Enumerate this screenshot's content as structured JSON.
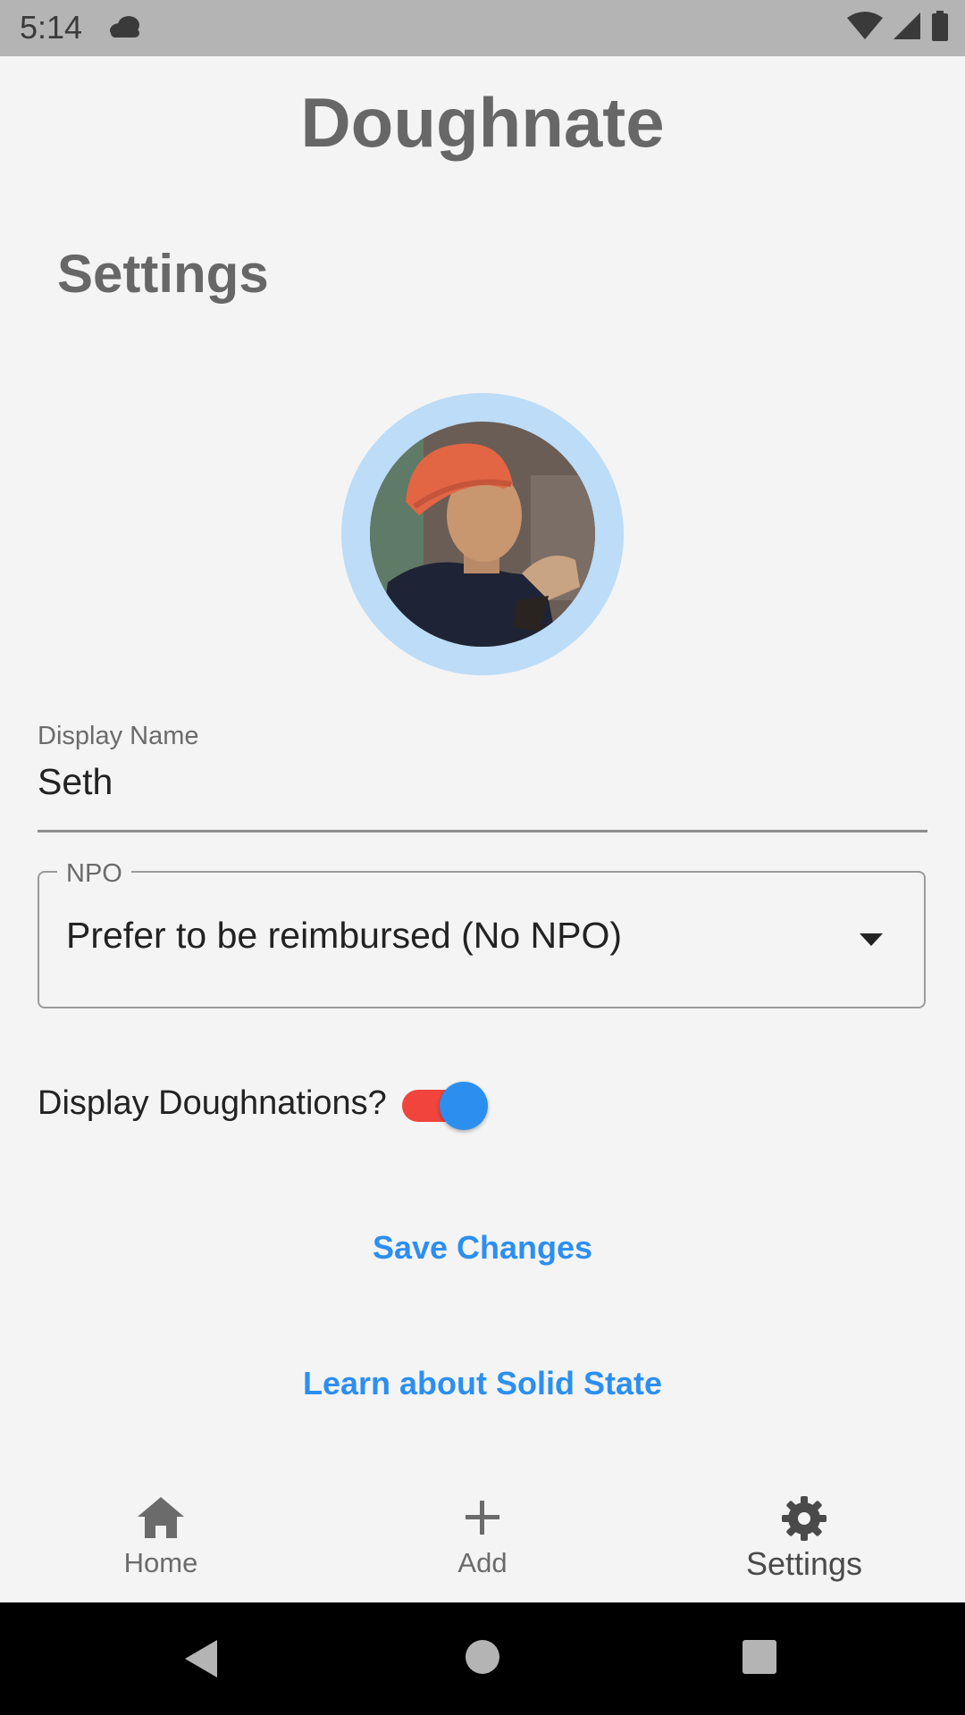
{
  "status_bar": {
    "time": "5:14"
  },
  "header": {
    "app_title": "Doughnate",
    "page_title": "Settings"
  },
  "profile": {
    "display_name_label": "Display Name",
    "display_name_value": "Seth"
  },
  "npo": {
    "label": "NPO",
    "selected": "Prefer to be reimbursed (No NPO)"
  },
  "toggle": {
    "label": "Display Doughnations?",
    "enabled": true
  },
  "buttons": {
    "save": "Save Changes",
    "learn": "Learn about Solid State"
  },
  "bottom_nav": {
    "items": [
      {
        "label": "Home",
        "icon": "home-icon"
      },
      {
        "label": "Add",
        "icon": "plus-icon"
      },
      {
        "label": "Settings",
        "icon": "gear-icon",
        "active": true
      }
    ]
  },
  "colors": {
    "accent": "#2c8ff0",
    "toggle_track": "#f0443c",
    "avatar_ring": "#bcdcf7",
    "title_gray": "#676767"
  }
}
